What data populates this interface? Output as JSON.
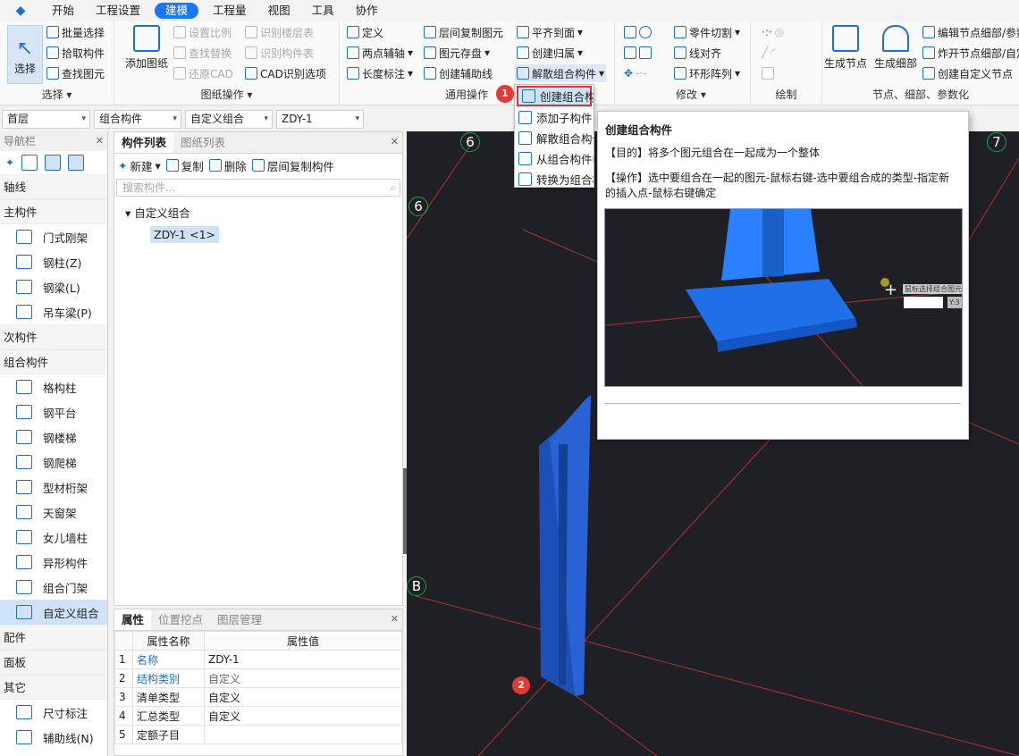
{
  "menu": {
    "items": [
      "开始",
      "工程设置",
      "建模",
      "工程量",
      "视图",
      "工具",
      "协作"
    ],
    "active_index": 2
  },
  "ribbon": {
    "select": {
      "big": "选择",
      "batch": "批量选择",
      "pick": "拾取构件",
      "find": "查找图元",
      "group": "选择"
    },
    "drawing": {
      "add": "添加图纸",
      "set_scale": "设置比例",
      "find_replace": "查找替换",
      "restore_cad": "还原CAD",
      "recognize_floors": "识别楼层表",
      "recognize_comp": "识别构件表",
      "cad_options": "CAD识别选项",
      "group": "图纸操作"
    },
    "general": {
      "define": "定义",
      "two_point_axis": "两点辅轴",
      "length_dim": "长度标注",
      "copy_floor": "层间复制图元",
      "save_elem": "图元存盘",
      "create_aux": "创建辅助线",
      "align_top": "平齐到面",
      "create_home": "创建归属",
      "dissolve": "解散组合构件",
      "group": "通用操作"
    },
    "modify": {
      "cut_part": "零件切割",
      "line_align": "线对齐",
      "ring_array": "环形阵列",
      "group": "修改"
    },
    "draw": {
      "group": "绘制"
    },
    "nodes": {
      "gen_node": "生成节点",
      "gen_detail": "生成细部",
      "edit_node": "编辑节点细部/参数",
      "explode_node": "炸开节点细部/自定义",
      "create_custom": "创建自定义节点",
      "group": "节点、细部、参数化"
    }
  },
  "filters": {
    "floor": "首层",
    "category": "组合构件",
    "type": "自定义组合",
    "item": "ZDY-1"
  },
  "navbar": {
    "title": "导航栏",
    "categories": {
      "axis": "轴线",
      "main": "主构件",
      "secondary": "次构件",
      "combo": "组合构件",
      "fittings": "配件",
      "panel": "面板",
      "other": "其它"
    },
    "main_items": [
      "门式刚架",
      "钢柱(Z)",
      "钢梁(L)",
      "吊车梁(P)"
    ],
    "combo_items": [
      "格构柱",
      "钢平台",
      "钢楼梯",
      "钢爬梯",
      "型材桁架",
      "天窗架",
      "女儿墙柱",
      "异形构件",
      "组合门架",
      "自定义组合"
    ],
    "other_items": [
      "尺寸标注",
      "辅助线(N)"
    ]
  },
  "complist": {
    "tabs": [
      "构件列表",
      "图纸列表"
    ],
    "new": "新建",
    "copy": "复制",
    "delete": "删除",
    "copy_floor": "层间复制构件",
    "search_placeholder": "搜索构件...",
    "tree_root": "自定义组合",
    "tree_item": "ZDY-1 <1>"
  },
  "props": {
    "tabs": [
      "属性",
      "位置挖点",
      "图层管理"
    ],
    "col_name": "属性名称",
    "col_value": "属性值",
    "rows": [
      {
        "n": "1",
        "name": "名称",
        "value": "ZDY-1"
      },
      {
        "n": "2",
        "name": "结构类别",
        "value": "自定义"
      },
      {
        "n": "3",
        "name": "清单类型",
        "value": "自定义"
      },
      {
        "n": "4",
        "name": "汇总类型",
        "value": "自定义"
      },
      {
        "n": "5",
        "name": "定额子目",
        "value": ""
      }
    ]
  },
  "dropdown": [
    "创建组合构件",
    "添加子构件",
    "解散组合构件",
    "从组合构件中",
    "转换为组合构"
  ],
  "tooltip": {
    "title": "创建组合构件",
    "purpose": "【目的】将多个图元组合在一起成为一个整体",
    "operation": "【操作】选中要组合在一起的图元-鼠标右键-选中要组合成的类型-指定新的插入点-鼠标右键确定",
    "hint": "鼠标选择组合图元",
    "x_value": "3105",
    "y_label": "Y:3"
  },
  "canvas": {
    "axes": [
      "6",
      "6",
      "7",
      "B"
    ]
  },
  "markers": [
    "1",
    "2"
  ],
  "colors": {
    "accent": "#1677ff",
    "canvas_bg": "#1f2026",
    "highlight_red": "#e03030",
    "axis_green": "#16a34a"
  }
}
